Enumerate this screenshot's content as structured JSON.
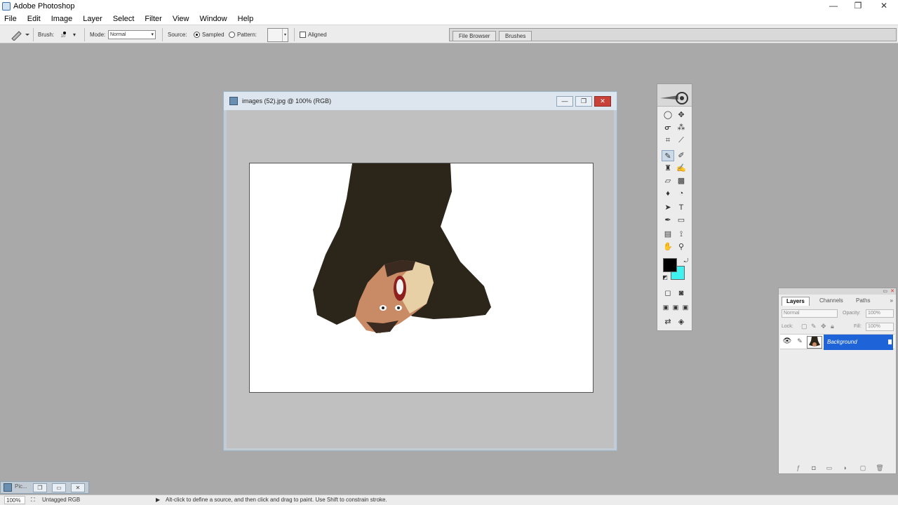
{
  "app": {
    "title": "Adobe Photoshop",
    "window_controls": [
      "—",
      "❐",
      "✕"
    ]
  },
  "menu": [
    "File",
    "Edit",
    "Image",
    "Layer",
    "Select",
    "Filter",
    "View",
    "Window",
    "Help"
  ],
  "options_bar": {
    "tool_icon": "healing-brush-icon",
    "brush_label": "Brush:",
    "brush_size": "10",
    "mode_label": "Mode:",
    "mode_value": "Normal",
    "source_label": "Source:",
    "sampled_label": "Sampled",
    "pattern_label": "Pattern:",
    "aligned_label": "Aligned",
    "source_selected": "Sampled"
  },
  "palette_well": {
    "tabs": [
      "File Browser",
      "Brushes"
    ]
  },
  "document": {
    "title": "images (52).jpg @ 100% (RGB)",
    "controls": [
      "—",
      "❐",
      "✕"
    ],
    "image_description_icon": "photo-canvas"
  },
  "toolbox": {
    "foreground_color": "#000000",
    "background_color": "#3ff2f0",
    "active_tool": "healing-brush"
  },
  "layers_panel": {
    "tabs": [
      "Layers",
      "Channels",
      "Paths"
    ],
    "blend_mode": "Normal",
    "opacity_label": "Opacity:",
    "opacity_value": "100%",
    "lock_label": "Lock:",
    "fill_label": "Fill:",
    "fill_value": "100%",
    "layer_name": "Background"
  },
  "minimized_window": {
    "label": "Pic..."
  },
  "status_bar": {
    "zoom": "100%",
    "doc_info": "Untagged RGB",
    "hint": "Alt-click to define a source, and then click and drag to paint. Use Shift to constrain stroke."
  }
}
